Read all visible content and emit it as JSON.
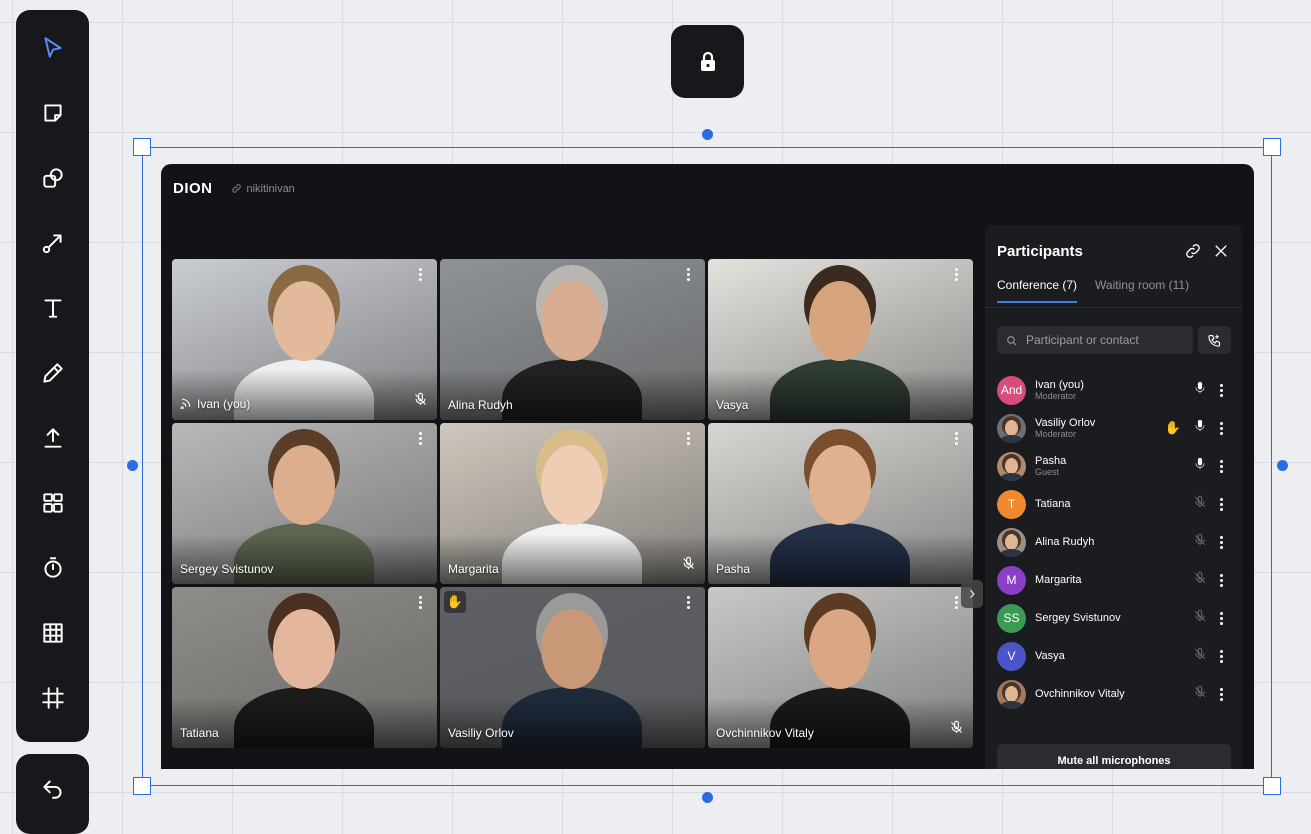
{
  "app": {
    "logo": "DION",
    "room_link": "nikitinivan"
  },
  "toolbar": {
    "tools": [
      {
        "name": "select-tool",
        "icon": "cursor-icon",
        "active": true
      },
      {
        "name": "sticky-note-tool",
        "icon": "sticky-note-icon"
      },
      {
        "name": "shapes-tool",
        "icon": "shapes-icon"
      },
      {
        "name": "connector-tool",
        "icon": "connector-icon"
      },
      {
        "name": "text-tool",
        "icon": "text-icon"
      },
      {
        "name": "pen-tool",
        "icon": "pen-icon"
      },
      {
        "name": "upload-tool",
        "icon": "upload-icon"
      },
      {
        "name": "templates-tool",
        "icon": "grid-icon"
      },
      {
        "name": "timer-tool",
        "icon": "timer-icon"
      },
      {
        "name": "table-tool",
        "icon": "table-icon"
      },
      {
        "name": "frame-tool",
        "icon": "frame-icon"
      }
    ],
    "undo_icon": "undo-icon",
    "lock_icon": "lock-icon"
  },
  "tiles": [
    {
      "name": "Ivan (you)",
      "speaking": true,
      "muted": true,
      "hand": false,
      "bg": "#c9ccd1",
      "skin": "#e2b99a",
      "shirt": "#eeeeee",
      "hair": "#8a6a44"
    },
    {
      "name": "Alina Rudyh",
      "speaking": false,
      "muted": false,
      "hand": false,
      "bg": "#8e9296",
      "skin": "#d9ad92",
      "shirt": "#222222",
      "hair": "#b9b6b1"
    },
    {
      "name": "Vasya",
      "speaking": false,
      "muted": false,
      "hand": false,
      "bg": "#e4e2dd",
      "skin": "#d6a57e",
      "shirt": "#2f3d33",
      "hair": "#3b2a1f"
    },
    {
      "name": "Sergey Svistunov",
      "speaking": false,
      "muted": false,
      "hand": false,
      "bg": "#b7b8b7",
      "skin": "#dcae8e",
      "shirt": "#5c6650",
      "hair": "#5a3e2a"
    },
    {
      "name": "Margarita",
      "speaking": false,
      "muted": true,
      "hand": false,
      "bg": "#cfc7bd",
      "skin": "#efcdb4",
      "shirt": "#f2f2f2",
      "hair": "#d8bd8b"
    },
    {
      "name": "Pasha",
      "speaking": false,
      "muted": false,
      "hand": false,
      "bg": "#d7d6d2",
      "skin": "#e0b090",
      "shirt": "#243048",
      "hair": "#7a4e2d"
    },
    {
      "name": "Tatiana",
      "speaking": false,
      "muted": false,
      "hand": false,
      "bg": "#8f8d88",
      "skin": "#e4b79c",
      "shirt": "#1b1b1b",
      "hair": "#4a3022"
    },
    {
      "name": "Vasiliy Orlov",
      "speaking": false,
      "muted": false,
      "hand": true,
      "bg": "#5e6066",
      "skin": "#c99877",
      "shirt": "#1e2a3a",
      "hair": "#9a9a98"
    },
    {
      "name": "Ovchinnikov Vitaly",
      "speaking": false,
      "muted": true,
      "hand": false,
      "bg": "#c8c8c6",
      "skin": "#d9a784",
      "shirt": "#1a1a1a",
      "hair": "#5b3b22"
    }
  ],
  "panel": {
    "title": "Participants",
    "tabs": [
      {
        "label": "Conference (7)",
        "active": true
      },
      {
        "label": "Waiting room (11)",
        "active": false
      }
    ],
    "search_placeholder": "Participant or contact",
    "participants": [
      {
        "name": "Ivan (you)",
        "role": "Moderator",
        "avatar_text": "And",
        "avatar_color": "#d64c7a",
        "photo": false,
        "mic": "on",
        "hand": false
      },
      {
        "name": "Vasiliy Orlov",
        "role": "Moderator",
        "avatar_text": "",
        "avatar_color": "#6b6f78",
        "photo": true,
        "mic": "on",
        "hand": true
      },
      {
        "name": "Pasha",
        "role": "Guest",
        "avatar_text": "",
        "avatar_color": "#b08a6a",
        "photo": true,
        "mic": "on",
        "hand": false
      },
      {
        "name": "Tatiana",
        "role": "",
        "avatar_text": "T",
        "avatar_color": "#ef8a2f",
        "photo": false,
        "mic": "muted",
        "hand": false
      },
      {
        "name": "Alina Rudyh",
        "role": "",
        "avatar_text": "",
        "avatar_color": "#9c8f86",
        "photo": true,
        "mic": "muted",
        "hand": false
      },
      {
        "name": "Margarita",
        "role": "",
        "avatar_text": "M",
        "avatar_color": "#8b3fc7",
        "photo": false,
        "mic": "muted",
        "hand": false
      },
      {
        "name": "Sergey Svistunov",
        "role": "",
        "avatar_text": "SS",
        "avatar_color": "#3a9b55",
        "photo": false,
        "mic": "muted",
        "hand": false
      },
      {
        "name": "Vasya",
        "role": "",
        "avatar_text": "V",
        "avatar_color": "#4a55c7",
        "photo": false,
        "mic": "muted",
        "hand": false
      },
      {
        "name": "Ovchinnikov Vitaly",
        "role": "",
        "avatar_text": "",
        "avatar_color": "#a07a5e",
        "photo": true,
        "mic": "muted",
        "hand": false
      }
    ],
    "mute_all_label": "Mute all microphones"
  }
}
